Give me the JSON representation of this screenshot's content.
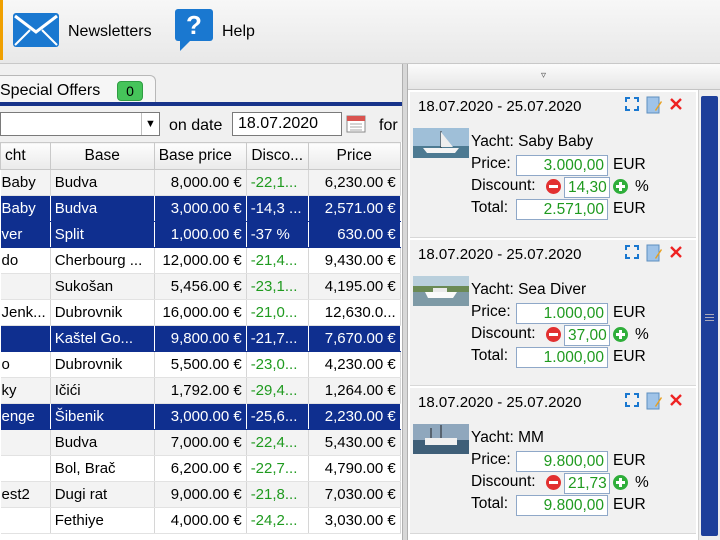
{
  "toolbar": {
    "newsletters_label": "Newsletters",
    "help_label": "Help",
    "newsletters_icon": "envelope-icon",
    "help_icon": "question-bubble-icon",
    "accent_color": "#1a78d0"
  },
  "tabs": {
    "special_offers_label": "Special Offers",
    "special_offers_count": "0"
  },
  "filter": {
    "combo_value": "",
    "on_date_label": "on date",
    "date_value": "18.07.2020",
    "for_label": "for"
  },
  "grid": {
    "columns": [
      "cht",
      "Base",
      "Base price",
      "Disco...",
      "Price"
    ],
    "rows": [
      {
        "yacht": "Baby",
        "base": "Budva",
        "base_price": "8,000.00 €",
        "discount": "-22,1...",
        "price": "6,230.00 €",
        "selected": false
      },
      {
        "yacht": "Baby",
        "base": "Budva",
        "base_price": "3,000.00 €",
        "discount": "-14,3 ...",
        "price": "2,571.00 €",
        "selected": true
      },
      {
        "yacht": "ver",
        "base": "Split",
        "base_price": "1,000.00 €",
        "discount": "-37 %",
        "price": "630.00 €",
        "selected": true
      },
      {
        "yacht": "do",
        "base": "Cherbourg ...",
        "base_price": "12,000.00 €",
        "discount": "-21,4...",
        "price": "9,430.00 €",
        "selected": false
      },
      {
        "yacht": "",
        "base": "Sukošan",
        "base_price": "5,456.00 €",
        "discount": "-23,1...",
        "price": "4,195.00 €",
        "selected": false
      },
      {
        "yacht": "Jenk...",
        "base": "Dubrovnik",
        "base_price": "16,000.00 €",
        "discount": "-21,0...",
        "price": "12,630.0...",
        "selected": false
      },
      {
        "yacht": "",
        "base": "Kaštel Go...",
        "base_price": "9,800.00 €",
        "discount": "-21,7...",
        "price": "7,670.00 €",
        "selected": true
      },
      {
        "yacht": "o",
        "base": "Dubrovnik",
        "base_price": "5,500.00 €",
        "discount": "-23,0...",
        "price": "4,230.00 €",
        "selected": false
      },
      {
        "yacht": "ky",
        "base": "Ičići",
        "base_price": "1,792.00 €",
        "discount": "-29,4...",
        "price": "1,264.00 €",
        "selected": false
      },
      {
        "yacht": "enge",
        "base": "Šibenik",
        "base_price": "3,000.00 €",
        "discount": "-25,6...",
        "price": "2,230.00 €",
        "selected": true
      },
      {
        "yacht": "",
        "base": "Budva",
        "base_price": "7,000.00 €",
        "discount": "-22,4...",
        "price": "5,430.00 €",
        "selected": false
      },
      {
        "yacht": "",
        "base": "Bol, Brač",
        "base_price": "6,200.00 €",
        "discount": "-22,7...",
        "price": "4,790.00 €",
        "selected": false
      },
      {
        "yacht": "est2",
        "base": "Dugi rat",
        "base_price": "9,000.00 €",
        "discount": "-21,8...",
        "price": "7,030.00 €",
        "selected": false
      },
      {
        "yacht": "",
        "base": "Fethiye",
        "base_price": "4,000.00 €",
        "discount": "-24,2...",
        "price": "3,030.00 €",
        "selected": false
      }
    ]
  },
  "offers": [
    {
      "period": "18.07.2020 - 25.07.2020",
      "yacht": "Yacht: Saby Baby",
      "price_label": "Price:",
      "price": "3.000,00",
      "discount_label": "Discount:",
      "discount": "14,30",
      "total_label": "Total:",
      "total": "2.571,00",
      "currency": "EUR",
      "percent": "%"
    },
    {
      "period": "18.07.2020 - 25.07.2020",
      "yacht": "Yacht: Sea Diver",
      "price_label": "Price:",
      "price": "1.000,00",
      "discount_label": "Discount:",
      "discount": "37,00",
      "total_label": "Total:",
      "total": "1.000,00",
      "currency": "EUR",
      "percent": "%"
    },
    {
      "period": "18.07.2020 - 25.07.2020",
      "yacht": "Yacht: MM",
      "price_label": "Price:",
      "price": "9.800,00",
      "discount_label": "Discount:",
      "discount": "21,73",
      "total_label": "Total:",
      "total": "9.800,00",
      "currency": "EUR",
      "percent": "%"
    }
  ],
  "colors": {
    "selection": "#0f2f8f",
    "discount_green": "#1f9a1f",
    "badge_green": "#46c45a"
  }
}
